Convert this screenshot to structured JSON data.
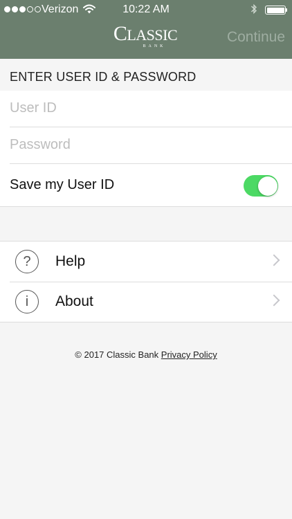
{
  "status_bar": {
    "carrier": "Verizon",
    "time": "10:22 AM",
    "signal_filled": 3,
    "signal_total": 5,
    "battery_level": 1.0
  },
  "header": {
    "logo_text": "CLASSIC",
    "logo_subtext": "BANK",
    "continue_label": "Continue"
  },
  "login": {
    "section_title": "ENTER USER ID & PASSWORD",
    "user_id_placeholder": "User ID",
    "user_id_value": "",
    "password_placeholder": "Password",
    "password_value": "",
    "save_label": "Save my User ID",
    "save_enabled": true
  },
  "menu": {
    "items": [
      {
        "label": "Help",
        "icon": "?"
      },
      {
        "label": "About",
        "icon": "i"
      }
    ]
  },
  "footer": {
    "copyright": "© 2017 Classic Bank",
    "privacy_label": "Privacy Policy"
  },
  "colors": {
    "header_bg": "#6b7f6e",
    "toggle_on": "#4cd964",
    "continue_disabled": "#9eada1"
  }
}
